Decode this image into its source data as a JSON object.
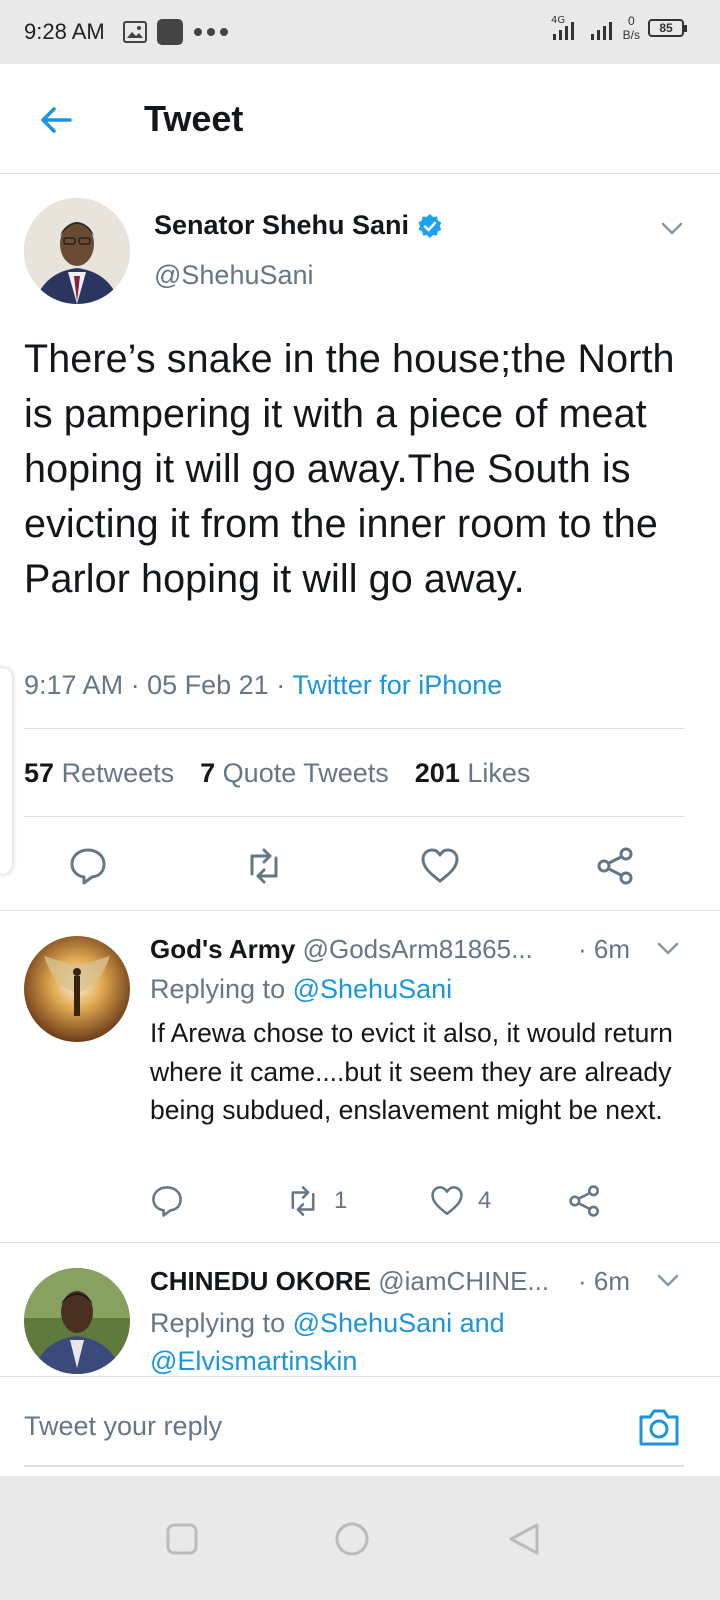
{
  "status_bar": {
    "time": "9:28 AM",
    "network": "4G",
    "data_speed_value": "0",
    "data_speed_unit": "B/s",
    "battery": "85"
  },
  "app_bar": {
    "title": "Tweet"
  },
  "tweet": {
    "author_name": "Senator Shehu Sani",
    "handle": "@ShehuSani",
    "text": "There’s snake in the house;the North is pampering it with a piece of meat hoping it will go away.The South is evicting it from the inner room to the Parlor hoping it will go away.",
    "time": "9:17 AM",
    "date": "05 Feb 21",
    "source": "Twitter for iPhone",
    "retweets_count": "57",
    "retweets_label": "Retweets",
    "quotes_count": "7",
    "quotes_label": "Quote Tweets",
    "likes_count": "201",
    "likes_label": "Likes"
  },
  "replies": [
    {
      "name": "God's Army",
      "handle": "@GodsArm81865...",
      "time": "· 6m",
      "replying_prefix": "Replying to",
      "replying_to": "@ShehuSani",
      "text": "If Arewa chose to evict it also, it would return where it came....but it seem they are already being subdued,  enslavement might be next.",
      "retweets": "1",
      "likes": "4"
    },
    {
      "name": "CHINEDU OKORE",
      "handle": "@iamCHINE...",
      "time": "· 6m",
      "replying_prefix": "Replying to",
      "replying_to": "@ShehuSani and @Elvismartinskin"
    }
  ],
  "reply_bar": {
    "placeholder": "Tweet your reply"
  },
  "colors": {
    "accent": "#1b95e0",
    "secondary_text": "#657786",
    "divider": "#dde1e4"
  }
}
